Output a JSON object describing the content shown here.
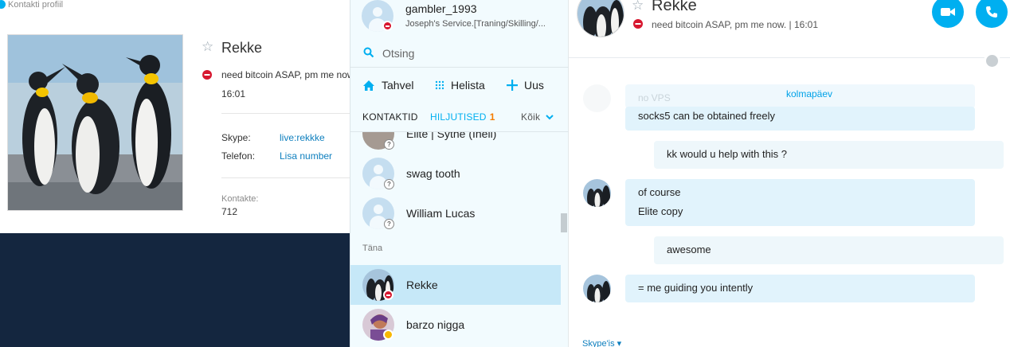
{
  "profile": {
    "bar_title": "Kontakti profiil",
    "name": "Rekke",
    "mood": "need bitcoin ASAP, pm me now",
    "time": "16:01",
    "fields": [
      {
        "label": "Skype:",
        "value": "live:rekkke"
      },
      {
        "label": "Telefon:",
        "value": "Lisa number"
      }
    ],
    "contacts_label": "Kontakte:",
    "contacts_count": "712"
  },
  "me": {
    "name": "gambler_1993",
    "sub": "Joseph's Service.[Traning/Skilling/..."
  },
  "search": {
    "placeholder": "Otsing"
  },
  "actions": {
    "home": "Tahvel",
    "call": "Helista",
    "new": "Uus"
  },
  "tabs": {
    "contacts": "KONTAKTID",
    "recent": "HILJUTISED",
    "recent_count": "1",
    "filter": "Kõik"
  },
  "contacts": [
    {
      "name": "Elite | Sythe (Ineli)",
      "status": "unknown"
    },
    {
      "name": "swag tooth",
      "status": "unknown"
    },
    {
      "name": "William Lucas",
      "status": "unknown"
    }
  ],
  "section_today": "Täna",
  "today": [
    {
      "name": "Rekke",
      "status": "dnd",
      "selected": true
    },
    {
      "name": "barzo nigga",
      "status": "away",
      "selected": false
    }
  ],
  "chat": {
    "name": "Rekke",
    "mood": "need bitcoin ASAP, pm me now.  |  16:01",
    "date_separator": "kolmapäev",
    "faded_text": "no VPS",
    "messages": [
      {
        "dir": "in",
        "lines": [
          "socks5 can be obtained freely"
        ]
      },
      {
        "dir": "out",
        "lines": [
          "kk would u help with this ?"
        ]
      },
      {
        "dir": "in",
        "lines": [
          "of course",
          "Elite copy"
        ]
      },
      {
        "dir": "out",
        "lines": [
          "awesome"
        ]
      },
      {
        "dir": "in",
        "lines": [
          "= me guiding you intently"
        ]
      }
    ],
    "skype_link": "Skype'is ▾"
  },
  "colors": {
    "accent": "#00aff0",
    "selected": "#c6e8f8",
    "navy": "#14263f",
    "dnd": "#d7172f"
  }
}
